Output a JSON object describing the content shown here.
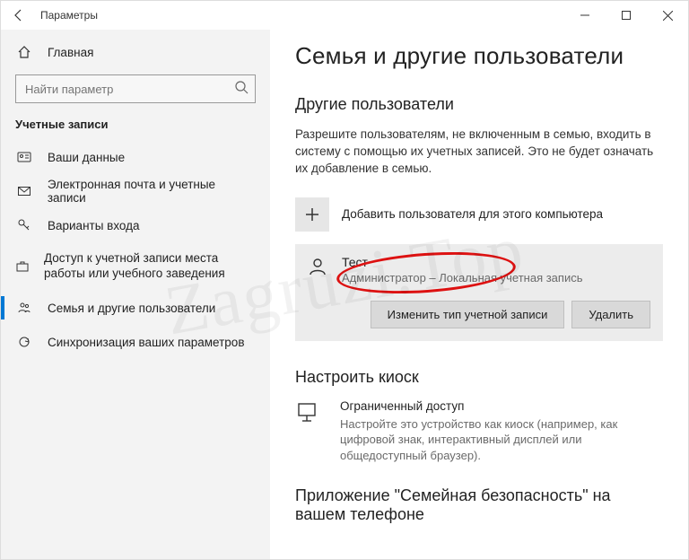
{
  "titlebar": {
    "title": "Параметры"
  },
  "sidebar": {
    "home": "Главная",
    "search_placeholder": "Найти параметр",
    "section": "Учетные записи",
    "items": [
      {
        "label": "Ваши данные"
      },
      {
        "label": "Электронная почта и учетные записи"
      },
      {
        "label": "Варианты входа"
      },
      {
        "label": "Доступ к учетной записи места работы или учебного заведения"
      },
      {
        "label": "Семья и другие пользователи"
      },
      {
        "label": "Синхронизация ваших параметров"
      }
    ]
  },
  "content": {
    "h1": "Семья и другие пользователи",
    "h2_other": "Другие пользователи",
    "other_desc": "Разрешите пользователям, не включенным в семью, входить в систему с помощью их учетных записей. Это не будет означать их добавление в семью.",
    "add_user": "Добавить пользователя для этого компьютера",
    "user": {
      "name": "Тест",
      "role": "Администратор – Локальная учетная запись",
      "change_type": "Изменить тип учетной записи",
      "delete": "Удалить"
    },
    "h2_kiosk": "Настроить киоск",
    "kiosk": {
      "title": "Ограниченный доступ",
      "desc": "Настройте это устройство как киоск (например, как цифровой знак, интерактивный дисплей или общедоступный браузер)."
    },
    "h2_app": "Приложение \"Семейная безопасность\" на вашем телефоне"
  },
  "watermark": "Zagruzi.Top"
}
